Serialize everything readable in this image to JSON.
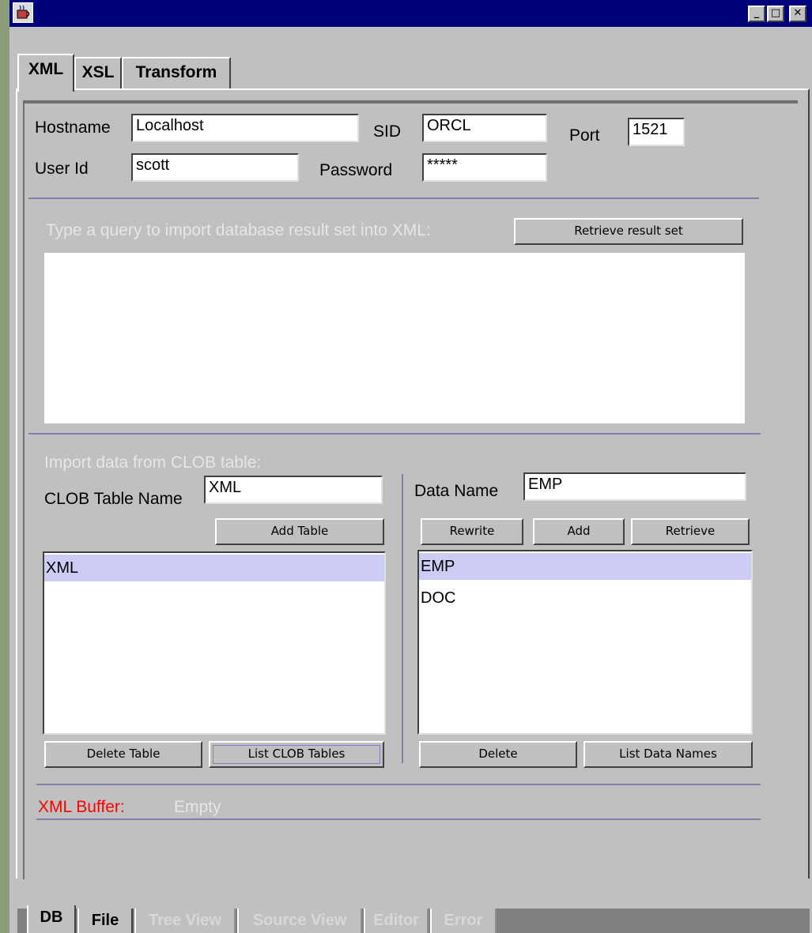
{
  "window": {
    "controls": {
      "minimize": "_",
      "maximize": "□",
      "close": "✕"
    }
  },
  "tabs": [
    "XML",
    "XSL",
    "Transform"
  ],
  "connection": {
    "hostname_label": "Hostname",
    "hostname_value": "Localhost",
    "sid_label": "SID",
    "sid_value": "ORCL",
    "port_label": "Port",
    "port_value": "1521",
    "userid_label": "User Id",
    "userid_value": "scott",
    "password_label": "Password",
    "password_value": "*****"
  },
  "query": {
    "prompt": "Type a query to import database result set into XML:",
    "retrieve_button": "Retrieve result set",
    "text": ""
  },
  "clob": {
    "section_label": "Import data from CLOB table:",
    "table_name_label": "CLOB Table Name",
    "table_name_value": "XML",
    "add_table_button": "Add Table",
    "tables": [
      "XML"
    ],
    "delete_table_button": "Delete Table",
    "list_tables_button": "List CLOB Tables",
    "data_name_label": "Data Name",
    "data_name_value": "EMP",
    "rewrite_button": "Rewrite",
    "add_button": "Add",
    "retrieve_button": "Retrieve",
    "data_names": [
      "EMP",
      "DOC"
    ],
    "delete_button": "Delete",
    "list_data_names_button": "List Data Names"
  },
  "buffer": {
    "label": "XML Buffer:",
    "status": "Empty",
    "label_color": "#ff0000"
  },
  "bottom_tabs": {
    "db": "DB",
    "file": "File",
    "tree_view": "Tree View",
    "source_view": "Source View",
    "editor": "Editor",
    "error": "Error"
  },
  "icons": {
    "app": "java-coffee-cup-icon"
  }
}
